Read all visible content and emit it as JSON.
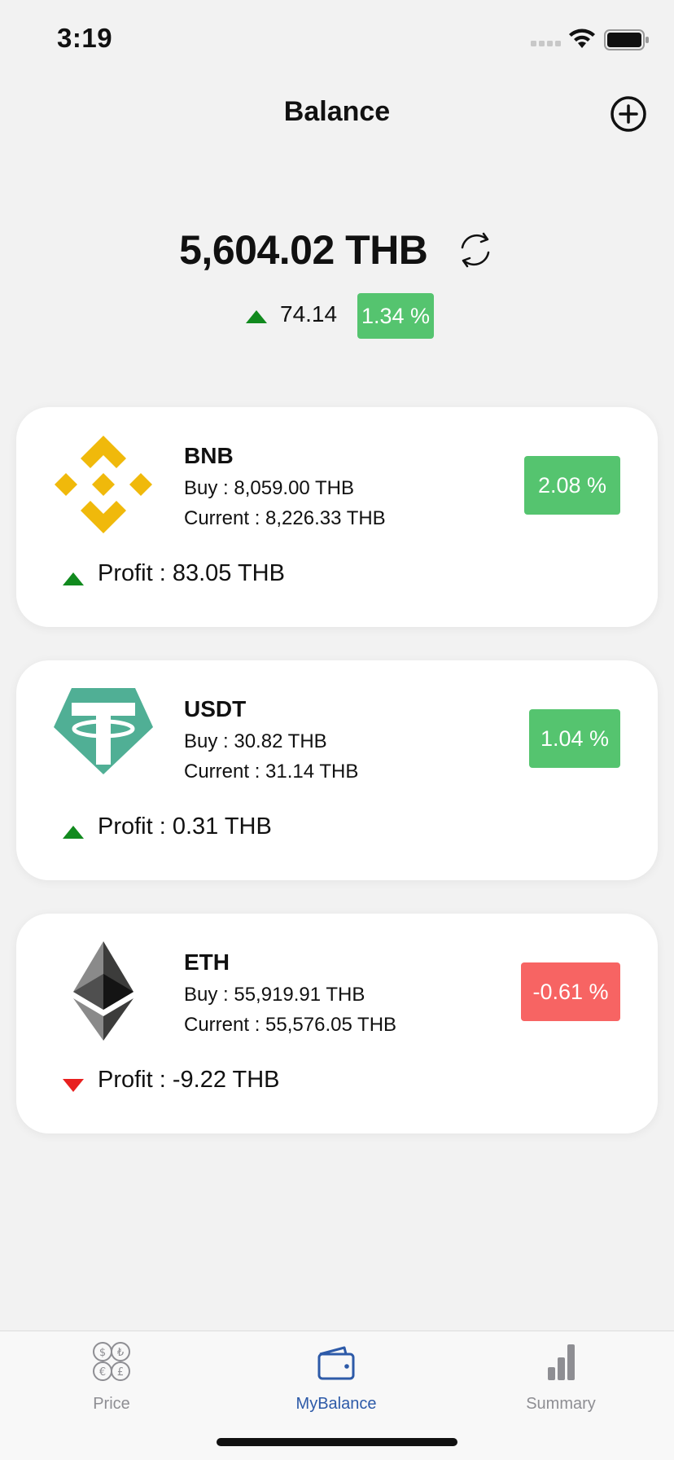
{
  "status_bar": {
    "time": "3:19"
  },
  "nav": {
    "title": "Balance"
  },
  "total": {
    "amount": "5,604.02 THB",
    "change_value": "74.14",
    "change_percent": "1.34 %",
    "direction": "up"
  },
  "coins": [
    {
      "name": "BNB",
      "buy": "Buy : 8,059.00 THB",
      "current": "Current : 8,226.33 THB",
      "percent": "2.08 %",
      "profit": "Profit : 83.05 THB",
      "direction": "up",
      "icon": "bnb-icon"
    },
    {
      "name": "USDT",
      "buy": "Buy : 30.82 THB",
      "current": "Current : 31.14 THB",
      "percent": "1.04 %",
      "profit": "Profit : 0.31 THB",
      "direction": "up",
      "icon": "usdt-icon"
    },
    {
      "name": "ETH",
      "buy": "Buy : 55,919.91 THB",
      "current": "Current : 55,576.05 THB",
      "percent": "-0.61 %",
      "profit": "Profit : -9.22 THB",
      "direction": "down",
      "icon": "eth-icon"
    }
  ],
  "tabs": [
    {
      "label": "Price",
      "icon": "currency-coins-icon",
      "active": false
    },
    {
      "label": "MyBalance",
      "icon": "wallet-icon",
      "active": true
    },
    {
      "label": "Summary",
      "icon": "bar-chart-icon",
      "active": false
    }
  ],
  "colors": {
    "positive": "#55c46f",
    "negative": "#f76463",
    "up_arrow": "#118a1e",
    "down_arrow": "#e8201f",
    "active_tab": "#2d5aa8"
  }
}
